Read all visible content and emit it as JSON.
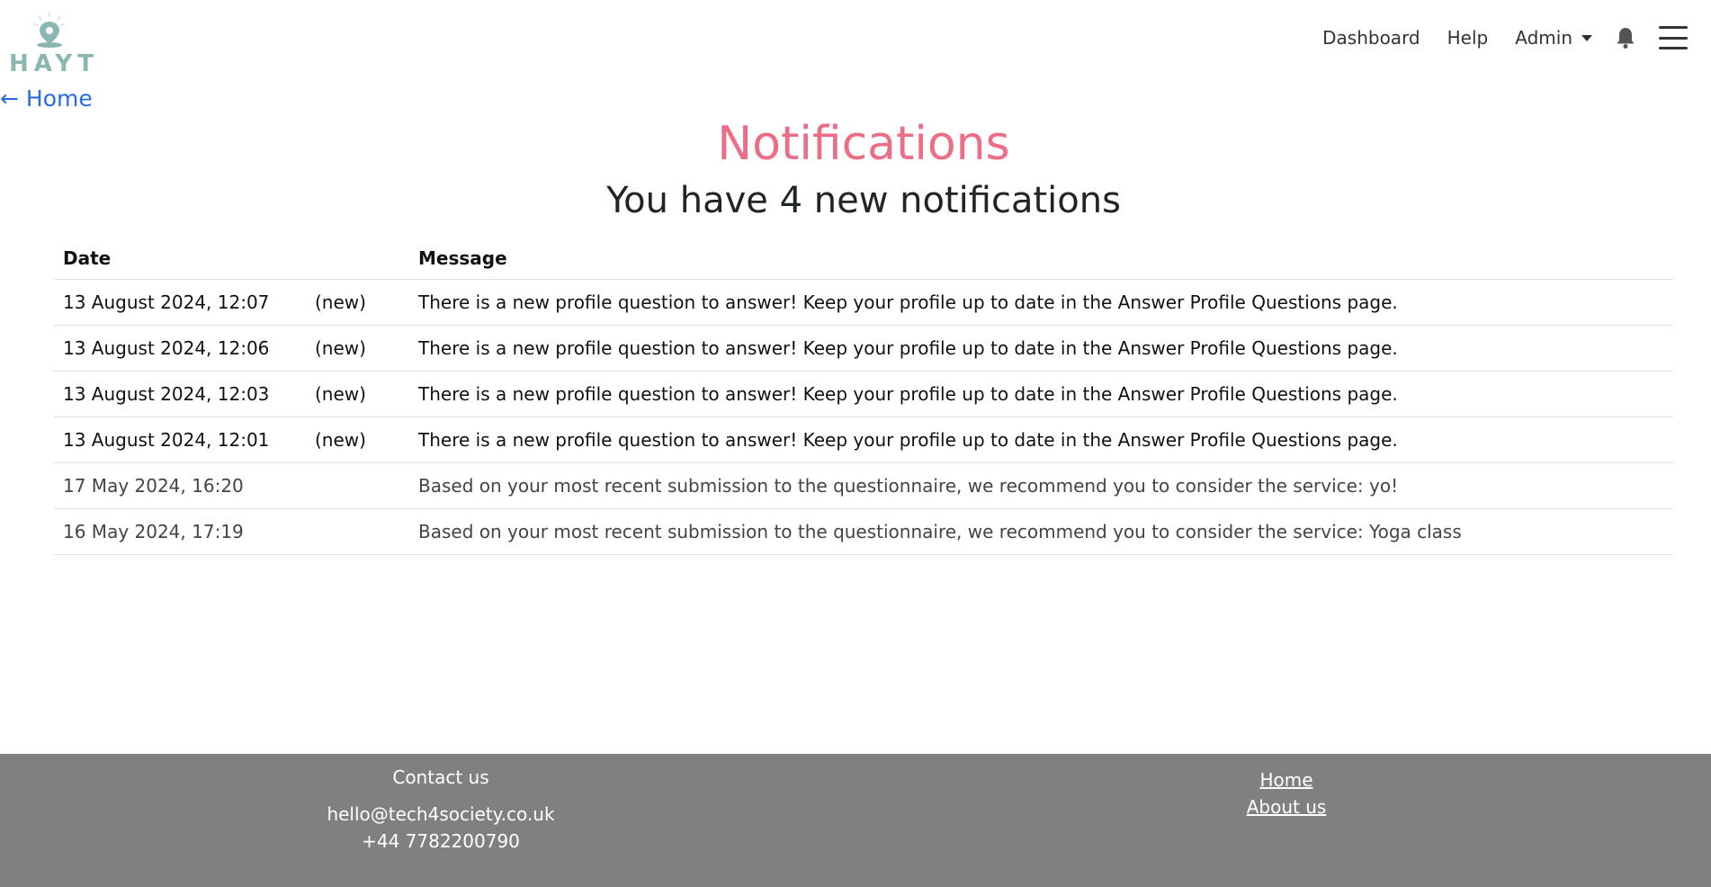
{
  "brand": {
    "name": "HAYT",
    "color": "#8ab8b0"
  },
  "back_link": "← Home",
  "nav": {
    "items": [
      "Dashboard",
      "Help",
      "Admin"
    ]
  },
  "page": {
    "title": "Notifications",
    "subtitle": "You have 4 new notifications"
  },
  "table": {
    "headers": [
      "Date",
      "",
      "Message"
    ],
    "rows": [
      {
        "date": "13 August 2024, 12:07",
        "status": "(new)",
        "message": "There is a new profile question to answer! Keep your profile up to date in the Answer Profile Questions page."
      },
      {
        "date": "13 August 2024, 12:06",
        "status": "(new)",
        "message": "There is a new profile question to answer! Keep your profile up to date in the Answer Profile Questions page."
      },
      {
        "date": "13 August 2024, 12:03",
        "status": "(new)",
        "message": "There is a new profile question to answer! Keep your profile up to date in the Answer Profile Questions page."
      },
      {
        "date": "13 August 2024, 12:01",
        "status": "(new)",
        "message": "There is a new profile question to answer! Keep your profile up to date in the Answer Profile Questions page."
      },
      {
        "date": "17 May 2024, 16:20",
        "status": "",
        "message": "Based on your most recent submission to the questionnaire, we recommend you to consider the service: yo!"
      },
      {
        "date": "16 May 2024, 17:19",
        "status": "",
        "message": "Based on your most recent submission to the questionnaire, we recommend you to consider the service: Yoga class"
      }
    ]
  },
  "footer": {
    "contact_heading": "Contact us",
    "email": "hello@tech4society.co.uk",
    "phone": "+44 7782200790",
    "links": [
      "Home",
      "About us"
    ]
  },
  "colors": {
    "title": "#ec6e86",
    "link": "#2b6be0",
    "footer_bg": "#808080"
  },
  "icons": [
    "location-pin-icon",
    "bell-icon",
    "hamburger-menu-icon",
    "caret-down-icon"
  ]
}
